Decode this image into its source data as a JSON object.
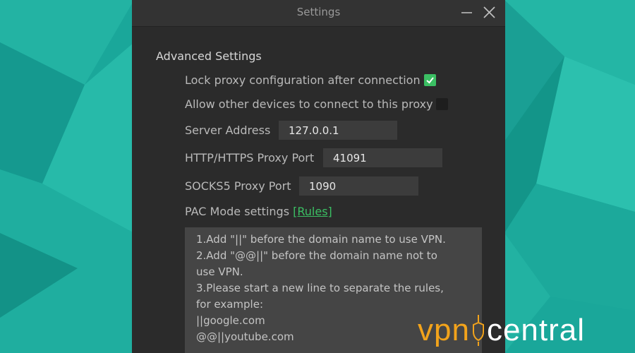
{
  "window": {
    "title": "Settings",
    "minimize_icon": "minimize-icon",
    "close_icon": "close-icon"
  },
  "advanced": {
    "heading": "Advanced Settings",
    "lock_proxy": {
      "label": "Lock proxy configuration after connection",
      "checked": true
    },
    "allow_devices": {
      "label": "Allow other devices to connect to this proxy",
      "checked": false
    },
    "server_address": {
      "label": "Server Address",
      "value": "127.0.0.1"
    },
    "http_port": {
      "label": "HTTP/HTTPS Proxy Port",
      "value": "41091"
    },
    "socks_port": {
      "label": "SOCKS5 Proxy Port",
      "value": "1090"
    },
    "pac": {
      "label": "PAC Mode settings",
      "link": "[Rules]"
    },
    "rules_text": [
      "1.Add \"||\" before the domain name to use VPN.",
      "2.Add \"@@||\" before the domain name not to",
      "use VPN.",
      "3.Please start a new line to separate the rules,",
      "for example:",
      "||google.com",
      "@@||youtube.com"
    ]
  },
  "watermark": {
    "brand_left": "vpn",
    "brand_right": "central"
  },
  "colors": {
    "accent": "#3bbf63",
    "background": "#1aa79a",
    "window": "#2b2b2b",
    "brand_orange": "#f2a31b"
  }
}
